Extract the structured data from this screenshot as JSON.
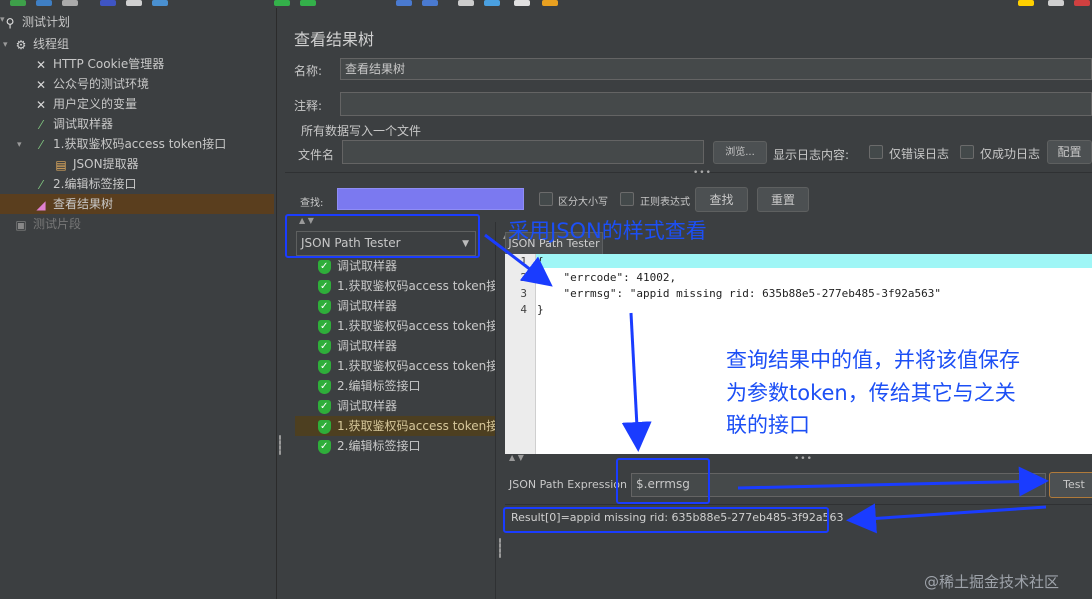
{
  "tree": {
    "items": [
      {
        "label": "测试计划",
        "icon": "test-plan-icon"
      },
      {
        "label": "线程组",
        "icon": "gear-icon"
      },
      {
        "label": "HTTP Cookie管理器",
        "icon": "wrench-icon"
      },
      {
        "label": "公众号的测试环境",
        "icon": "wrench-icon"
      },
      {
        "label": "用户定义的变量",
        "icon": "wrench-icon"
      },
      {
        "label": "调试取样器",
        "icon": "pipette-icon"
      },
      {
        "label": "1.获取鉴权码access token接口",
        "icon": "pipette-icon"
      },
      {
        "label": "JSON提取器",
        "icon": "extractor-icon"
      },
      {
        "label": "2.编辑标签接口",
        "icon": "pipette-icon"
      },
      {
        "label": "查看结果树",
        "icon": "chart-icon"
      },
      {
        "label": "测试片段",
        "icon": "fragment-icon"
      }
    ]
  },
  "panel": {
    "title": "查看结果树",
    "name_label": "名称:",
    "name_value": "查看结果树",
    "comment_label": "注释:",
    "comment_value": "",
    "write_all_label": "所有数据写入一个文件",
    "filename_label": "文件名",
    "filename_value": "",
    "browse_button": "浏览...",
    "log_content_label": "显示日志内容:",
    "errors_only_label": "仅错误日志",
    "success_only_label": "仅成功日志",
    "configure_button": "配置"
  },
  "search": {
    "label": "查找:",
    "value": "",
    "case_sensitive_label": "区分大小写",
    "regex_label": "正则表达式",
    "find_button": "查找",
    "reset_button": "重置"
  },
  "renderer": {
    "selected": "JSON Path Tester"
  },
  "results": [
    {
      "label": "调试取样器",
      "selected": false
    },
    {
      "label": "1.获取鉴权码access token接口",
      "selected": false
    },
    {
      "label": "调试取样器",
      "selected": false
    },
    {
      "label": "1.获取鉴权码access token接口",
      "selected": false
    },
    {
      "label": "调试取样器",
      "selected": false
    },
    {
      "label": "1.获取鉴权码access token接口",
      "selected": false
    },
    {
      "label": "2.编辑标签接口",
      "selected": false
    },
    {
      "label": "调试取样器",
      "selected": false
    },
    {
      "label": "1.获取鉴权码access token接口",
      "selected": true
    },
    {
      "label": "2.编辑标签接口",
      "selected": false
    }
  ],
  "tester": {
    "tab_label": "JSON Path Tester",
    "code_lines": [
      {
        "num": "1",
        "text": "{"
      },
      {
        "num": "2",
        "text": "    \"errcode\": 41002,"
      },
      {
        "num": "3",
        "text": "    \"errmsg\": \"appid missing rid: 635b88e5-277eb485-3f92a563\""
      },
      {
        "num": "4",
        "text": "}"
      }
    ],
    "expression_label": "JSON Path Expression",
    "expression_value": "$.errmsg",
    "test_button": "Test",
    "result_text": "Result[0]=appid missing rid: 635b88e5-277eb485-3f92a563"
  },
  "annotations": {
    "json_style": "采用JSON的样式查看",
    "query_line1": "查询结果中的值，并将该值保存",
    "query_line2": "为参数token，传给其它与之关",
    "query_line3": "联的接口"
  },
  "watermark": "@稀土掘金技术社区",
  "colors": {
    "annotation_blue": "#1a3cff",
    "search_field": "#7b79f0",
    "selection_orange": "#5a3e1e",
    "editor_highlight": "#9ff6f6"
  }
}
